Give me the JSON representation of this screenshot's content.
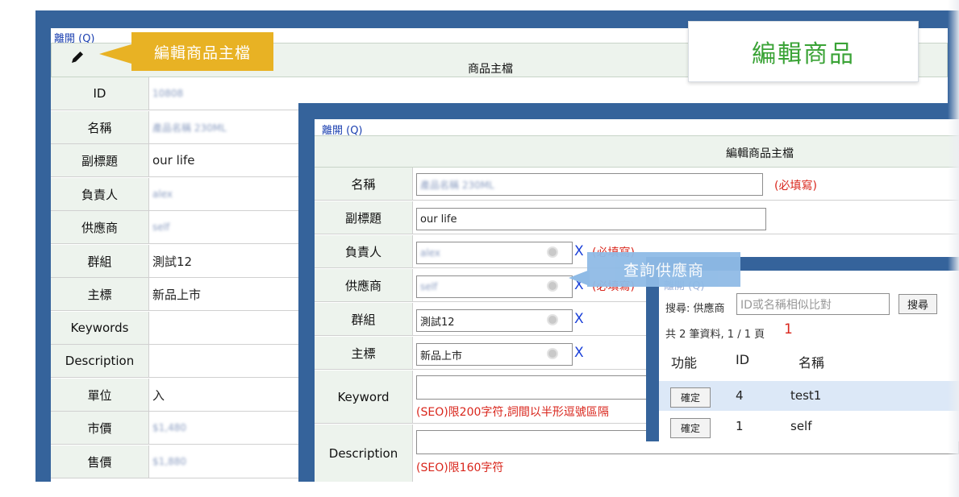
{
  "win1": {
    "leave": "離開 (Q)",
    "title": "商品主檔",
    "rows": [
      {
        "label": "ID",
        "value": "10808",
        "blurred": true
      },
      {
        "label": "名稱",
        "value": "產品名稱 230ML",
        "blurred": true
      },
      {
        "label": "副標題",
        "value": "our life",
        "blurred": false
      },
      {
        "label": "負責人",
        "value": "alex",
        "blurred": true
      },
      {
        "label": "供應商",
        "value": "self",
        "blurred": true
      },
      {
        "label": "群組",
        "value": "測試12",
        "blurred": false
      },
      {
        "label": "主標",
        "value": "新品上市",
        "blurred": false
      },
      {
        "label": "Keywords",
        "value": "",
        "blurred": false
      },
      {
        "label": "Description",
        "value": "",
        "blurred": false
      },
      {
        "label": "單位",
        "value": "入",
        "blurred": false
      },
      {
        "label": "市價",
        "value": "$1,480",
        "blurred": true
      },
      {
        "label": "售價",
        "value": "$1,880",
        "blurred": true
      }
    ]
  },
  "callout_edit": "編輯商品主檔",
  "banner": "編輯商品",
  "win2": {
    "leave": "離開 (Q)",
    "title": "編輯商品主檔",
    "name_label": "名稱",
    "name_value": "產品名稱 230ML",
    "name_required": "(必填寫)",
    "subtitle_label": "副標題",
    "subtitle_value": "our life",
    "owner_label": "負責人",
    "owner_value": "alex",
    "owner_required": "(必填寫)",
    "supplier_label": "供應商",
    "supplier_value": "self",
    "supplier_required": "(必填寫)",
    "group_label": "群組",
    "group_value": "測試12",
    "main_label": "主標",
    "main_value": "新品上市",
    "clear": "X",
    "keyword_label": "Keyword",
    "keyword_note": "(SEO)限200字符,詞間以半形逗號區隔",
    "desc_label": "Description",
    "desc_note": "(SEO)限160字符"
  },
  "callout_supplier": "查詢供應商",
  "win3": {
    "leave": "離開 (Q)",
    "search_label": "搜尋: 供應商",
    "search_placeholder": "ID或名稱相似比對",
    "search_button": "搜尋",
    "count": "共 2 筆資料, 1 / 1 頁",
    "mark": "1",
    "headers": [
      "功能",
      "ID",
      "名稱"
    ],
    "rows": [
      {
        "action": "確定",
        "id": "4",
        "name": "test1",
        "highlight": true
      },
      {
        "action": "確定",
        "id": "1",
        "name": "self",
        "highlight": false
      }
    ]
  },
  "colors": {
    "frame": "#35639b",
    "label_bg": "#edf3ed",
    "callout_yellow": "#e8b224",
    "callout_blue": "#8fbbe6",
    "banner_green": "#3aa336",
    "required_red": "#d9261c",
    "row_highlight": "#dce8f7"
  },
  "icons": [
    "pencil-icon",
    "search-icon"
  ]
}
